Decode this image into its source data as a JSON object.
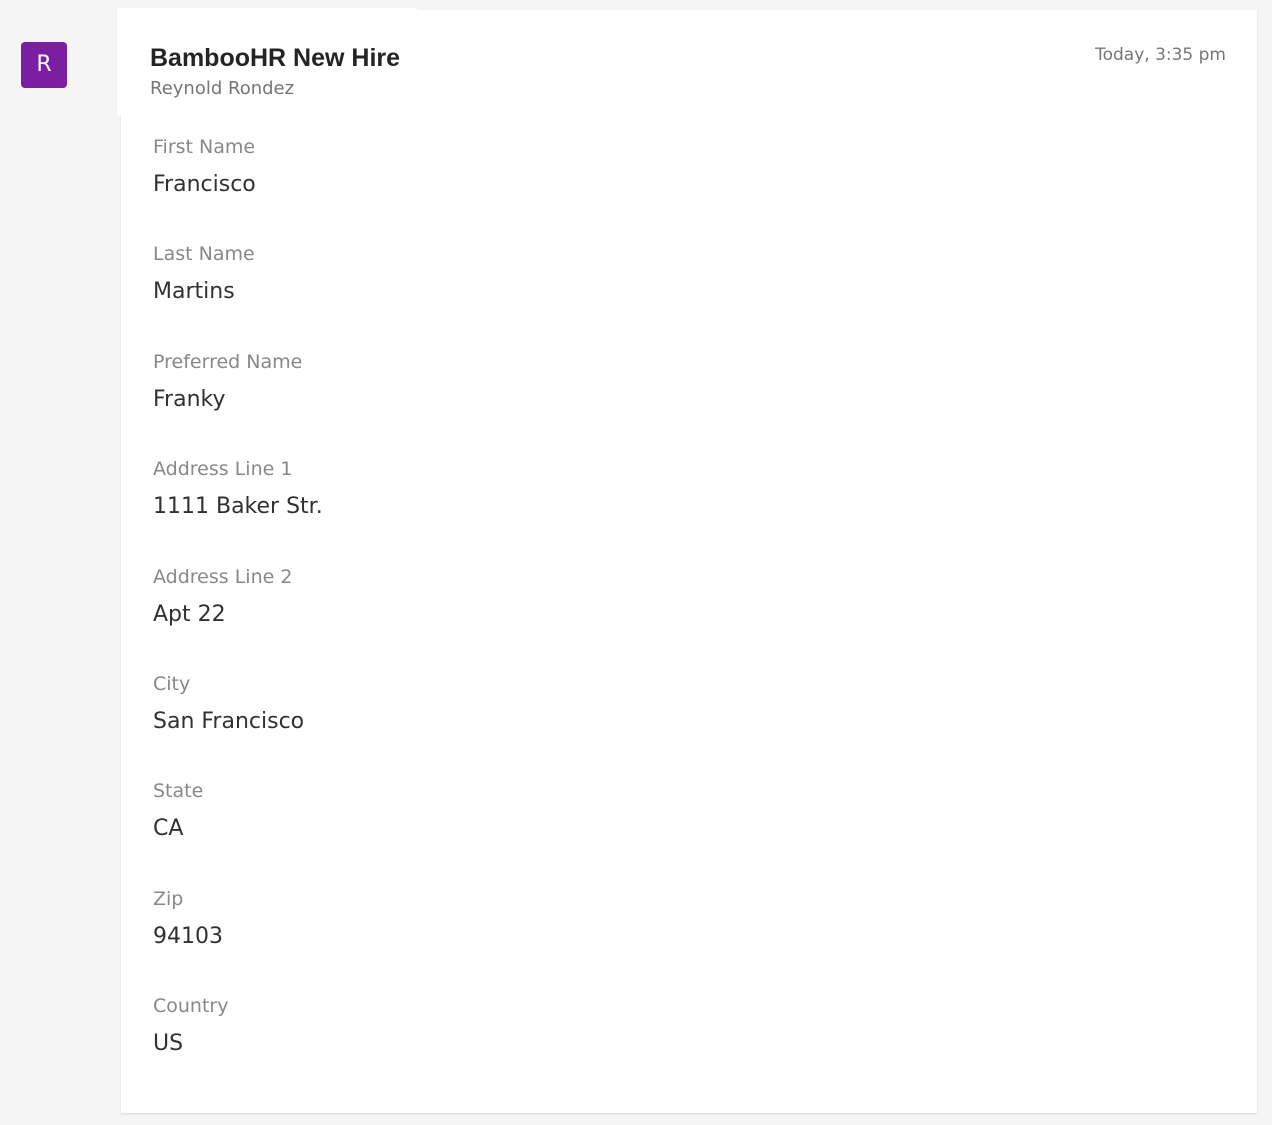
{
  "avatar": {
    "initial": "R",
    "color": "#7b1fa2"
  },
  "message": {
    "title": "BambooHR New Hire",
    "sender": "Reynold Rondez",
    "timestamp": "Today, 3:35 pm"
  },
  "fields": [
    {
      "label": "First Name",
      "value": "Francisco"
    },
    {
      "label": "Last Name",
      "value": "Martins"
    },
    {
      "label": "Preferred Name",
      "value": "Franky"
    },
    {
      "label": "Address Line 1",
      "value": "1111 Baker Str."
    },
    {
      "label": "Address Line 2",
      "value": "Apt 22"
    },
    {
      "label": "City",
      "value": "San Francisco"
    },
    {
      "label": "State",
      "value": "CA"
    },
    {
      "label": "Zip",
      "value": "94103"
    },
    {
      "label": "Country",
      "value": "US"
    }
  ]
}
